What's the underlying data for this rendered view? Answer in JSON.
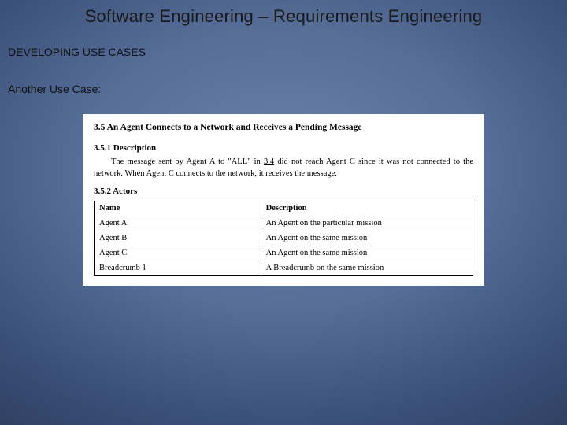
{
  "slide": {
    "title": "Software Engineering – Requirements Engineering",
    "section": "DEVELOPING USE CASES",
    "subheading": "Another Use Case:"
  },
  "doc": {
    "heading_number": "3.5",
    "heading_text": "An Agent Connects to a Network and Receives a Pending Message",
    "description_label": "3.5.1 Description",
    "description_body_pre": "The message sent by Agent A to \"ALL\" in ",
    "description_ref": "3.4",
    "description_body_post": " did not reach Agent C since it was not connected to the network. When Agent C connects to the network, it receives the message.",
    "actors_label": "3.5.2 Actors",
    "table": {
      "headers": {
        "name": "Name",
        "description": "Description"
      },
      "rows": [
        {
          "name": "Agent A",
          "description": "An Agent on the particular mission"
        },
        {
          "name": "Agent B",
          "description": "An Agent on the same mission"
        },
        {
          "name": "Agent C",
          "description": "An Agent on the same mission"
        },
        {
          "name": "Breadcrumb 1",
          "description": "A Breadcrumb on the same mission"
        }
      ]
    }
  }
}
